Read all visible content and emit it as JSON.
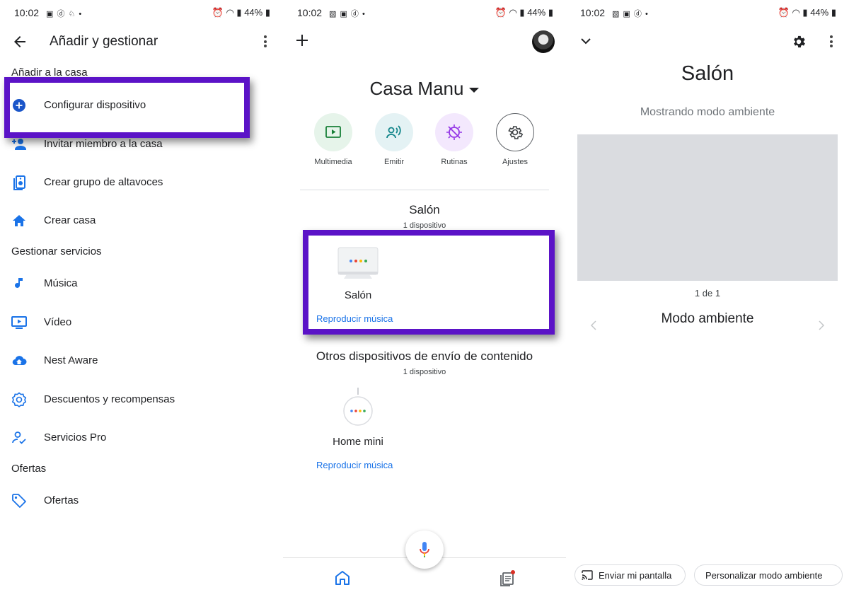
{
  "status_bar": {
    "time": "10:02",
    "battery": "44%"
  },
  "panel1": {
    "title": "Añadir y gestionar",
    "section_add": "Añadir a la casa",
    "item_configure": "Configurar dispositivo",
    "item_invite": "Invitar miembro a la casa",
    "item_speaker_group": "Crear grupo de altavoces",
    "item_create_home": "Crear casa",
    "section_services": "Gestionar servicios",
    "item_music": "Música",
    "item_video": "Vídeo",
    "item_nest_aware": "Nest Aware",
    "item_offers_rewards": "Descuentos y recompensas",
    "item_pro": "Servicios Pro",
    "section_offers": "Ofertas",
    "item_offers": "Ofertas"
  },
  "panel2": {
    "home_name": "Casa Manu",
    "shortcuts": {
      "media": "Multimedia",
      "cast": "Emitir",
      "routines": "Rutinas",
      "settings": "Ajustes"
    },
    "room1": {
      "title": "Salón",
      "count": "1 dispositivo",
      "device_name": "Salón",
      "action": "Reproducir música"
    },
    "room2": {
      "title": "Otros dispositivos de envío de contenido",
      "count": "1 dispositivo",
      "device_name": "Home mini",
      "action": "Reproducir música"
    }
  },
  "panel3": {
    "title": "Salón",
    "subtitle": "Mostrando modo ambiente",
    "pager": "1 de 1",
    "mode_title": "Modo ambiente",
    "chip_cast": "Enviar mi pantalla",
    "chip_customize": "Personalizar modo ambiente"
  },
  "colors": {
    "highlight": "#5b13c7",
    "accent_blue": "#1a73e8",
    "icon_blue": "#1a73e8",
    "media_bg": "#e6f4ea",
    "cast_bg": "#e4f2f4",
    "routines_bg": "#f3e8fd"
  },
  "icons": {
    "back": "arrow-back-icon",
    "more": "more-vert-icon",
    "add": "add-icon",
    "settings": "gear-icon",
    "mic": "mic-icon",
    "home_tab": "home-icon",
    "feed_tab": "feed-icon"
  }
}
